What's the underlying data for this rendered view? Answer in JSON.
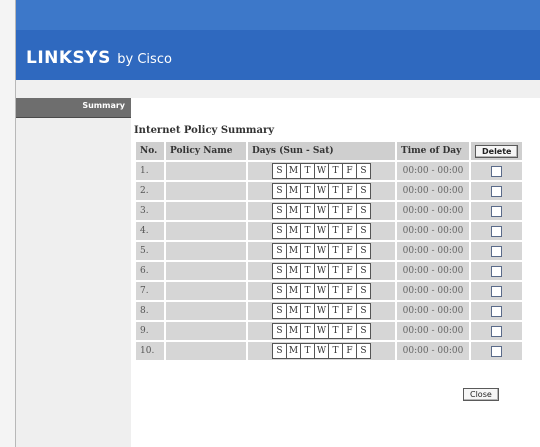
{
  "header": {
    "brand": "LINKSYS",
    "brand_suffix": "by Cisco"
  },
  "sidebar": {
    "active_tab": "Summary"
  },
  "summary": {
    "title": "Internet Policy Summary",
    "columns": {
      "no": "No.",
      "policy_name": "Policy Name",
      "days": "Days (Sun - Sat)",
      "time": "Time of Day",
      "delete": "Delete"
    },
    "day_letters": [
      "S",
      "M",
      "T",
      "W",
      "T",
      "F",
      "S"
    ],
    "rows": [
      {
        "no": "1.",
        "name": "",
        "time": "00:00 - 00:00",
        "checked": false
      },
      {
        "no": "2.",
        "name": "",
        "time": "00:00 - 00:00",
        "checked": false
      },
      {
        "no": "3.",
        "name": "",
        "time": "00:00 - 00:00",
        "checked": false
      },
      {
        "no": "4.",
        "name": "",
        "time": "00:00 - 00:00",
        "checked": false
      },
      {
        "no": "5.",
        "name": "",
        "time": "00:00 - 00:00",
        "checked": false
      },
      {
        "no": "6.",
        "name": "",
        "time": "00:00 - 00:00",
        "checked": false
      },
      {
        "no": "7.",
        "name": "",
        "time": "00:00 - 00:00",
        "checked": false
      },
      {
        "no": "8.",
        "name": "",
        "time": "00:00 - 00:00",
        "checked": false
      },
      {
        "no": "9.",
        "name": "",
        "time": "00:00 - 00:00",
        "checked": false
      },
      {
        "no": "10.",
        "name": "",
        "time": "00:00 - 00:00",
        "checked": false
      }
    ],
    "close_label": "Close"
  },
  "colors": {
    "header_blue": "#2f69bf",
    "top_blue": "#3d78c9",
    "sidebar_tab": "#6e6e6e"
  }
}
